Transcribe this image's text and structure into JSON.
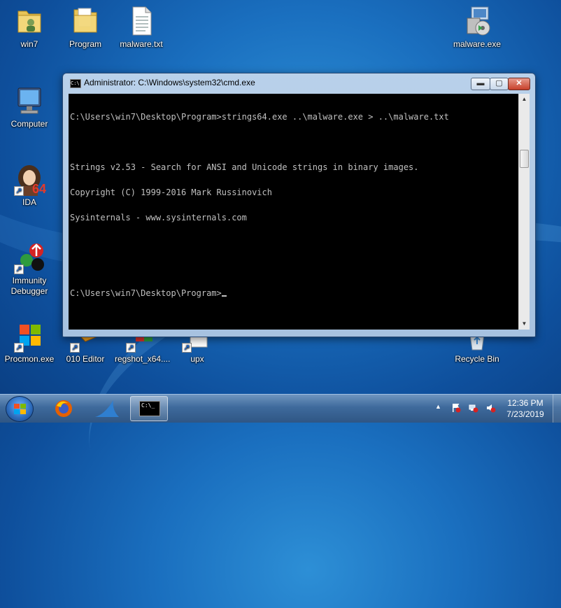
{
  "desktop": {
    "icons": {
      "win7": "win7",
      "program": "Program",
      "malware_txt": "malware.txt",
      "malware_exe": "malware.exe",
      "computer": "Computer",
      "ida": "IDA",
      "ida_badge": "64",
      "immunity": "Immunity Debugger",
      "procmon": "Procmon.exe",
      "editor010": "010 Editor",
      "regshot": "regshot_x64....",
      "upx": "upx",
      "recycle": "Recycle Bin"
    }
  },
  "window": {
    "title": "Administrator: C:\\Windows\\system32\\cmd.exe",
    "icon_text": "C:\\",
    "buttons": {
      "minimize": "▬",
      "maximize": "▢",
      "close": "✕"
    },
    "console_lines": [
      "C:\\Users\\win7\\Desktop\\Program>strings64.exe ..\\malware.exe > ..\\malware.txt",
      "",
      "Strings v2.53 - Search for ANSI and Unicode strings in binary images.",
      "Copyright (C) 1999-2016 Mark Russinovich",
      "Sysinternals - www.sysinternals.com",
      "",
      "",
      "C:\\Users\\win7\\Desktop\\Program>"
    ]
  },
  "taskbar": {
    "cmd_icon_text": "C:\\_",
    "tray_show_hidden": "▲",
    "clock_time": "12:36 PM",
    "clock_date": "7/23/2019"
  },
  "colors": {
    "desktop": "#1a6fbf",
    "console_bg": "#000000",
    "console_fg": "#c0c0c0",
    "taskbar": "#3e6a9c"
  }
}
